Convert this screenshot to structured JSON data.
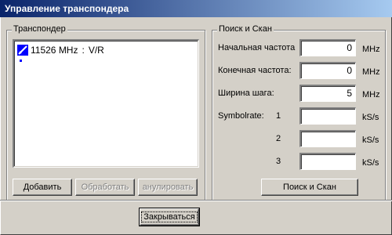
{
  "window": {
    "title": "Управление транспондера"
  },
  "transponder_group": {
    "legend": "Транспондер",
    "items": [
      {
        "frequency": "11526 MHz",
        "separator": ":",
        "polarization": "V/R"
      }
    ],
    "buttons": {
      "add": "Добавить",
      "process": "Обработать",
      "cancel": "анулировать"
    }
  },
  "scan_group": {
    "legend": "Поиск и Скан",
    "start_freq_label": "Начальная частота",
    "start_freq_value": "0",
    "end_freq_label": "Конечная частота:",
    "end_freq_value": "0",
    "step_label": "Ширина шага:",
    "step_value": "5",
    "freq_unit": "MHz",
    "symbolrate_label": "Symbolrate:",
    "symbolrate_rows": [
      {
        "index": "1",
        "value": "",
        "unit": "kS/s"
      },
      {
        "index": "2",
        "value": "",
        "unit": "kS/s"
      },
      {
        "index": "3",
        "value": "",
        "unit": "kS/s"
      }
    ],
    "scan_button": "Поиск и Скан"
  },
  "footer": {
    "close_button": "Закрываться"
  },
  "colors": {
    "titlebar_start": "#0a246a",
    "titlebar_end": "#a6caf0",
    "face": "#d4d0c8",
    "icon_blue": "#0000ff"
  }
}
